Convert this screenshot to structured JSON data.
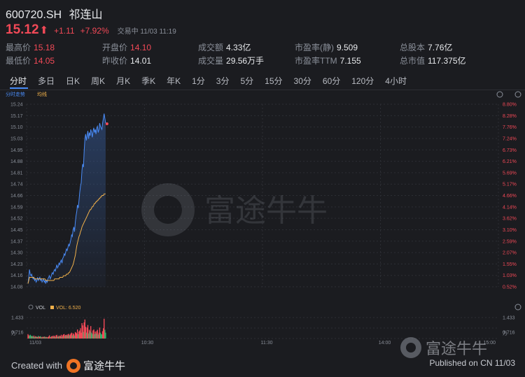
{
  "header": {
    "code": "600720.SH",
    "name": "祁连山",
    "price": "15.12",
    "arrow": "⬆",
    "change": "+1.11",
    "change_pct": "+7.92%",
    "trade_status": "交易中 11/03 11:19"
  },
  "metrics": [
    {
      "label": "最高价",
      "value": "15.18",
      "tone": "up"
    },
    {
      "label": "最低价",
      "value": "14.05",
      "tone": "up"
    },
    {
      "label": "开盘价",
      "value": "14.10",
      "tone": "up"
    },
    {
      "label": "昨收价",
      "value": "14.01",
      "tone": "plain"
    },
    {
      "label": "成交额",
      "value": "4.33亿",
      "tone": "plain"
    },
    {
      "label": "成交量",
      "value": "29.56万手",
      "tone": "plain"
    },
    {
      "label": "市盈率(静)",
      "value": "9.509",
      "tone": "plain"
    },
    {
      "label": "市盈率TTM",
      "value": "7.155",
      "tone": "plain"
    },
    {
      "label": "总股本",
      "value": "7.76亿",
      "tone": "plain"
    },
    {
      "label": "总市值",
      "value": "117.375亿",
      "tone": "plain"
    }
  ],
  "tabs": [
    "分时",
    "多日",
    "日K",
    "周K",
    "月K",
    "季K",
    "年K",
    "1分",
    "3分",
    "5分",
    "15分",
    "30分",
    "60分",
    "120分",
    "4小时"
  ],
  "active_tab": "分时",
  "chart_legend": {
    "intraday": "分时走势",
    "avg": "均线"
  },
  "vol_legend": {
    "label": "VOL",
    "value": "VOL: 6.520"
  },
  "footer": {
    "created_prefix": "Created with",
    "brand": "富途牛牛",
    "published": "Published on CN 11/03"
  },
  "colors": {
    "up": "#f24957",
    "down": "#2fb36b",
    "price_line": "#4a8cf7",
    "avg_line": "#f0b04a",
    "background": "#1b1c20",
    "grid": "#2c2e34"
  },
  "chart_data": [
    {
      "type": "line",
      "title": "",
      "series": [
        {
          "name": "分时走势",
          "values": [
            14.1,
            14.14,
            14.19,
            14.16,
            14.15,
            14.16,
            14.14,
            14.13,
            14.14,
            14.12,
            14.13,
            14.11,
            14.12,
            14.14,
            14.12,
            14.13,
            14.14,
            14.12,
            14.13,
            14.11,
            14.12,
            14.13,
            14.11,
            14.12,
            14.1,
            14.12,
            14.11,
            14.13,
            14.14,
            14.15,
            14.13,
            14.14,
            14.16,
            14.17,
            14.16,
            14.18,
            14.19,
            14.18,
            14.2,
            14.22,
            14.2,
            14.21,
            14.23,
            14.22,
            14.24,
            14.25,
            14.23,
            14.26,
            14.27,
            14.29,
            14.28,
            14.3,
            14.32,
            14.31,
            14.33,
            14.35,
            14.34,
            14.36,
            14.38,
            14.41,
            14.4,
            14.44,
            14.46,
            14.43,
            14.49,
            14.53,
            14.56,
            14.6,
            14.58,
            14.63,
            14.68,
            14.72,
            14.74,
            14.82,
            14.86,
            14.84,
            14.94,
            15.02,
            15.05,
            15.01,
            15.04,
            15.07,
            15.02,
            15.06,
            15.04,
            15.08,
            15.06,
            15.03,
            15.07,
            15.09,
            15.06,
            15.08,
            15.05,
            15.09,
            15.1,
            15.06,
            15.08,
            15.12,
            15.1,
            15.09,
            15.08,
            15.12,
            15.15,
            15.18,
            15.15,
            15.12
          ]
        },
        {
          "name": "均线",
          "values": [
            14.1,
            14.12,
            14.14,
            14.14,
            14.14,
            14.14,
            14.14,
            14.14,
            14.14,
            14.13,
            14.13,
            14.13,
            14.13,
            14.13,
            14.13,
            14.13,
            14.13,
            14.13,
            14.13,
            14.13,
            14.13,
            14.13,
            14.13,
            14.13,
            14.12,
            14.12,
            14.12,
            14.12,
            14.12,
            14.12,
            14.12,
            14.12,
            14.12,
            14.12,
            14.12,
            14.12,
            14.13,
            14.13,
            14.13,
            14.13,
            14.13,
            14.13,
            14.13,
            14.14,
            14.14,
            14.14,
            14.14,
            14.14,
            14.15,
            14.15,
            14.15,
            14.15,
            14.16,
            14.16,
            14.16,
            14.17,
            14.17,
            14.18,
            14.19,
            14.2,
            14.21,
            14.22,
            14.24,
            14.26,
            14.28,
            14.31,
            14.34,
            14.36,
            14.38,
            14.4,
            14.41,
            14.43,
            14.44,
            14.46,
            14.47,
            14.48,
            14.49,
            14.5,
            14.51,
            14.52,
            14.53,
            14.54,
            14.55,
            14.56,
            14.57,
            14.57,
            14.58,
            14.59,
            14.59,
            14.6,
            14.61,
            14.61,
            14.62,
            14.62,
            14.63,
            14.63,
            14.64,
            14.64,
            14.65,
            14.65,
            14.66,
            14.66,
            14.66,
            14.67,
            14.67,
            14.67
          ]
        }
      ],
      "y_ticks": [
        "15.24",
        "15.17",
        "15.10",
        "15.03",
        "14.95",
        "14.88",
        "14.81",
        "14.74",
        "14.66",
        "14.59",
        "14.52",
        "14.45",
        "14.37",
        "14.30",
        "14.23",
        "14.16",
        "14.08"
      ],
      "y_right_ticks": [
        "8.80%",
        "8.28%",
        "7.76%",
        "7.24%",
        "6.73%",
        "6.21%",
        "5.69%",
        "5.17%",
        "4.66%",
        "4.14%",
        "3.62%",
        "3.10%",
        "2.59%",
        "2.07%",
        "1.55%",
        "1.03%",
        "0.52%"
      ],
      "ylim": [
        14.08,
        15.24
      ],
      "x_ticks": [
        "11/03",
        "10:30",
        "11:30",
        "14:00",
        "15:00"
      ],
      "grid": true
    },
    {
      "type": "bar",
      "title": "VOL",
      "y_ticks": [
        "1.433",
        "0.716",
        "万"
      ],
      "y_right_ticks": [
        "1.433",
        "0.716",
        "万"
      ],
      "ylim": [
        0,
        1.433
      ],
      "series": [
        {
          "name": "VOL",
          "values": [
            0.3,
            0.22,
            0.18,
            0.26,
            0.2,
            0.15,
            0.18,
            0.12,
            0.2,
            0.1,
            0.16,
            0.14,
            0.12,
            0.1,
            0.18,
            0.12,
            0.14,
            0.16,
            0.1,
            0.08,
            0.12,
            0.1,
            0.14,
            0.12,
            0.09,
            0.11,
            0.08,
            0.1,
            0.14,
            0.22,
            0.12,
            0.1,
            0.15,
            0.18,
            0.12,
            0.2,
            0.16,
            0.1,
            0.22,
            0.25,
            0.14,
            0.12,
            0.2,
            0.15,
            0.18,
            0.26,
            0.12,
            0.22,
            0.28,
            0.3,
            0.18,
            0.24,
            0.26,
            0.2,
            0.28,
            0.32,
            0.22,
            0.26,
            0.34,
            0.4,
            0.22,
            0.36,
            0.3,
            0.2,
            0.44,
            0.4,
            0.35,
            0.62,
            0.3,
            0.48,
            0.55,
            0.7,
            0.4,
            1.05,
            0.9,
            0.45,
            1.1,
            1.3,
            0.8,
            0.4,
            0.75,
            0.92,
            0.35,
            0.6,
            0.5,
            0.85,
            0.4,
            0.3,
            0.55,
            0.62,
            0.3,
            0.48,
            0.35,
            0.5,
            0.6,
            0.28,
            0.4,
            0.75,
            0.4,
            0.3,
            0.28,
            0.5,
            0.7,
            1.35,
            0.6,
            0.4
          ]
        }
      ],
      "bar_colors": [
        "up",
        "up",
        "down",
        "down",
        "down",
        "up",
        "down",
        "down",
        "up",
        "down",
        "up",
        "down",
        "up",
        "up",
        "down",
        "up",
        "up",
        "down",
        "up",
        "down",
        "up",
        "up",
        "down",
        "up",
        "down",
        "up",
        "down",
        "up",
        "up",
        "up",
        "down",
        "up",
        "up",
        "up",
        "down",
        "up",
        "up",
        "down",
        "up",
        "up",
        "down",
        "up",
        "up",
        "down",
        "up",
        "up",
        "down",
        "up",
        "up",
        "up",
        "down",
        "up",
        "up",
        "down",
        "up",
        "up",
        "down",
        "up",
        "up",
        "up",
        "down",
        "up",
        "up",
        "down",
        "up",
        "up",
        "up",
        "up",
        "down",
        "up",
        "up",
        "up",
        "up",
        "up",
        "up",
        "down",
        "up",
        "up",
        "up",
        "down",
        "up",
        "up",
        "down",
        "up",
        "down",
        "up",
        "down",
        "down",
        "up",
        "up",
        "down",
        "up",
        "down",
        "up",
        "up",
        "down",
        "up",
        "up",
        "down",
        "down",
        "down",
        "up",
        "up",
        "up",
        "down",
        "down"
      ],
      "x_ticks": [
        "11/03",
        "10:30",
        "11:30",
        "14:00",
        "15:00"
      ]
    }
  ]
}
